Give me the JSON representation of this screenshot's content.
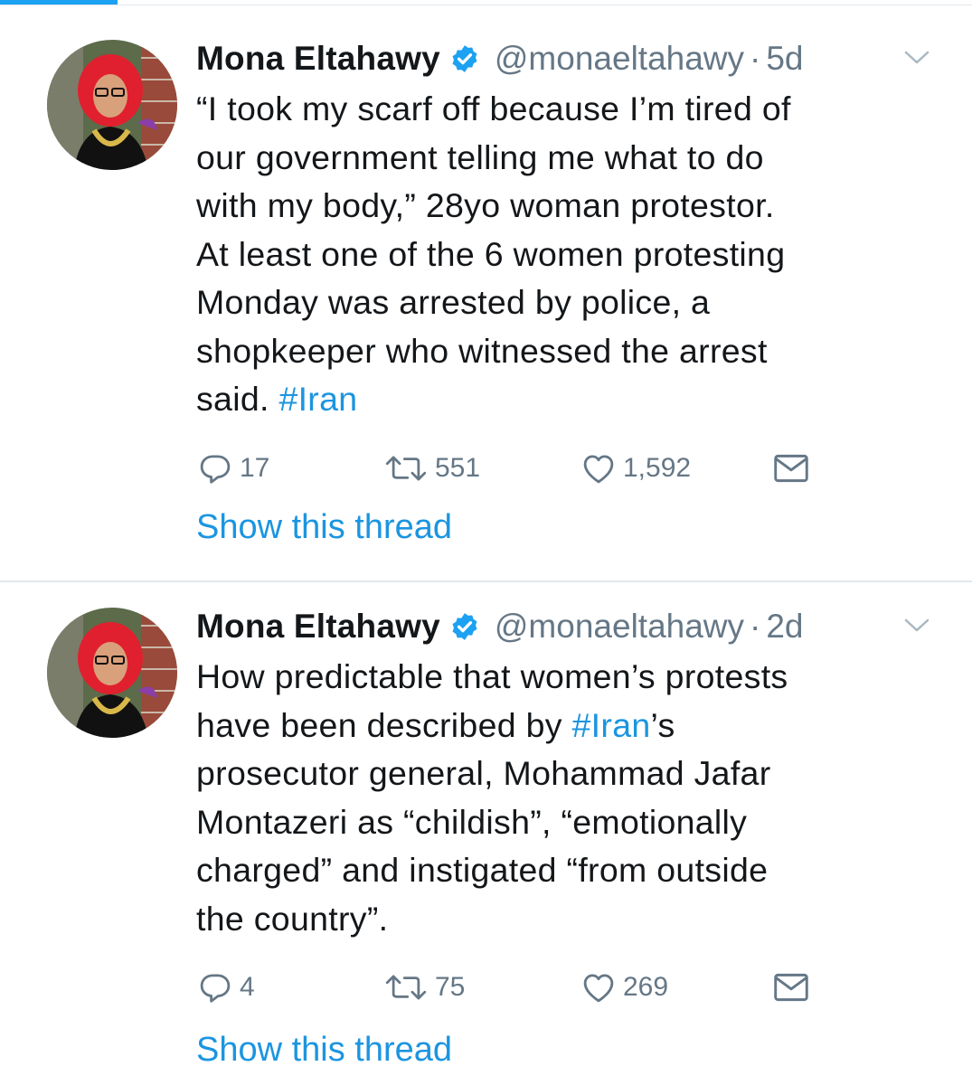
{
  "tweets": [
    {
      "name": "Mona Eltahawy",
      "handle": "@monaeltahawy",
      "separator": "·",
      "time": "5d",
      "body_parts": [
        {
          "text": "“I took my scarf off because I’m tired of\nour government telling me what to do\nwith my body,” 28yo woman protestor.\nAt least one of the 6 women protesting\nMonday was arrested by police, a\nshopkeeper who witnessed the arrest\nsaid. ",
          "hashtag": false
        },
        {
          "text": "#Iran",
          "hashtag": true
        }
      ],
      "replies": "17",
      "retweets": "551",
      "likes": "1,592",
      "show_thread": "Show this thread"
    },
    {
      "name": "Mona Eltahawy",
      "handle": "@monaeltahawy",
      "separator": "·",
      "time": "2d",
      "body_parts": [
        {
          "text": "How predictable that women’s protests\nhave been described by ",
          "hashtag": false
        },
        {
          "text": "#Iran",
          "hashtag": true
        },
        {
          "text": "’s\nprosecutor general, Mohammad Jafar\nMontazeri as “childish”, “emotionally\ncharged” and instigated “from outside\nthe country”.",
          "hashtag": false
        }
      ],
      "replies": "4",
      "retweets": "75",
      "likes": "269",
      "show_thread": "Show this thread"
    }
  ],
  "icons": {
    "verified": "verified-badge-icon",
    "caret": "chevron-down-icon",
    "reply": "reply-icon",
    "retweet": "retweet-icon",
    "like": "heart-icon",
    "dm": "envelope-icon"
  },
  "colors": {
    "accent": "#1da1f2",
    "link": "#1b95e0",
    "muted": "#657786",
    "text": "#14171a"
  }
}
